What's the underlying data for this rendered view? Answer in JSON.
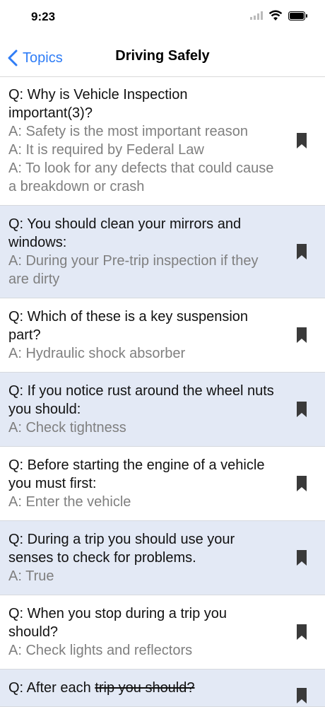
{
  "status": {
    "time": "9:23"
  },
  "nav": {
    "back_label": "Topics",
    "title": "Driving Safely"
  },
  "items": [
    {
      "q": "Q: Why is Vehicle Inspection important(3)?",
      "a": [
        "A: Safety is the most important reason",
        "A: It is required by Federal Law",
        "A: To look for any defects that could cause a breakdown or crash"
      ]
    },
    {
      "q": "Q: You should clean your mirrors and windows:",
      "a": [
        "A: During your Pre-trip inspection if they are dirty"
      ]
    },
    {
      "q": "Q: Which of these is a key suspension part?",
      "a": [
        "A: Hydraulic shock absorber"
      ]
    },
    {
      "q": "Q: If you notice rust around the wheel nuts you should:",
      "a": [
        "A: Check tightness"
      ]
    },
    {
      "q": "Q: Before starting the engine of a vehicle you must first:",
      "a": [
        "A: Enter the vehicle"
      ]
    },
    {
      "q": "Q: During a trip you should use your senses to check for problems.",
      "a": [
        "A: True"
      ]
    },
    {
      "q": "Q: When you stop during a trip you should?",
      "a": [
        "A: Check lights and reflectors"
      ]
    },
    {
      "q_prefix": "Q: After each ",
      "q_struck": "trip you should?"
    }
  ],
  "colors": {
    "accent": "#2f7df6",
    "alt_row": "#e3e9f5",
    "answer": "#7f7f7f"
  },
  "icons": {
    "bookmark": "bookmark-icon",
    "back": "chevron-left-icon"
  }
}
